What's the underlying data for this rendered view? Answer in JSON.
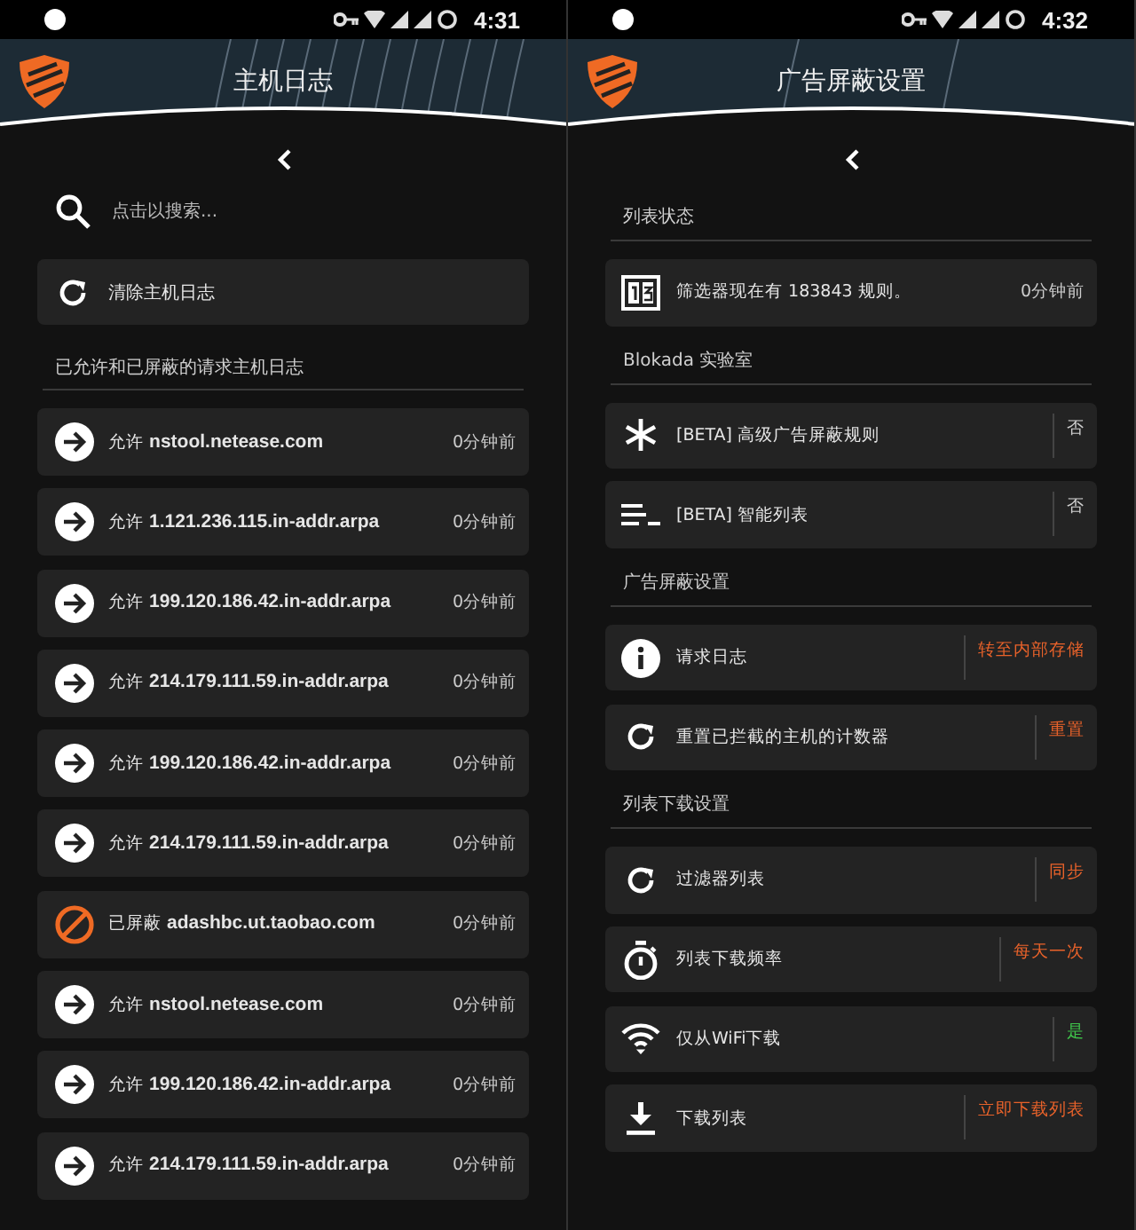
{
  "screens": [
    {
      "status_bar": {
        "time": "4:31"
      },
      "title": "主机日志",
      "search": {
        "placeholder": "点击以搜索..."
      },
      "clear_button": "清除主机日志",
      "section": "已允许和已屏蔽的请求主机日志",
      "log": [
        {
          "kind": "allowed",
          "text": "允许 **nstool.netease.com**",
          "time": "0分钟前"
        },
        {
          "kind": "allowed",
          "text": "允许 **1.121.236.115.in-addr.arpa**",
          "time": "0分钟前"
        },
        {
          "kind": "allowed",
          "text": "允许 **199.120.186.42.in-addr.arpa**",
          "time": "0分钟前"
        },
        {
          "kind": "allowed",
          "text": "允许 **214.179.111.59.in-addr.arpa**",
          "time": "0分钟前"
        },
        {
          "kind": "allowed",
          "text": "允许 **199.120.186.42.in-addr.arpa**",
          "time": "0分钟前"
        },
        {
          "kind": "allowed",
          "text": "允许 **214.179.111.59.in-addr.arpa**",
          "time": "0分钟前"
        },
        {
          "kind": "blocked",
          "text": "已屏蔽 **adashbc.ut.taobao.com**",
          "time": "0分钟前"
        },
        {
          "kind": "allowed",
          "text": "允许 **nstool.netease.com**",
          "time": "0分钟前"
        },
        {
          "kind": "allowed",
          "text": "允许 **199.120.186.42.in-addr.arpa**",
          "time": "0分钟前"
        },
        {
          "kind": "allowed",
          "text": "允许 **214.179.111.59.in-addr.arpa**",
          "time": "0分钟前"
        }
      ]
    },
    {
      "status_bar": {
        "time": "4:32"
      },
      "title": "广告屏蔽设置",
      "sections": [
        {
          "title": "列表状态",
          "items": [
            {
              "kind": "counter",
              "label": "筛选器现在有 183843 规则。",
              "time": "0分钟前"
            }
          ]
        },
        {
          "title": "Blokada 实验室",
          "items": [
            {
              "kind": "asterisk",
              "label": "[BETA] 高级广告屏蔽规则",
              "value": "否",
              "color": "#cfcfcf"
            },
            {
              "kind": "lines",
              "label": "[BETA] 智能列表",
              "value": "否",
              "color": "#cfcfcf"
            }
          ]
        },
        {
          "title": "广告屏蔽设置",
          "items": [
            {
              "kind": "info",
              "label": "请求日志",
              "value": "转至内部存储",
              "color": "#e8622a"
            },
            {
              "kind": "reset",
              "label": "重置已拦截的主机的计数器",
              "value": "重置",
              "color": "#e8622a"
            }
          ]
        },
        {
          "title": "列表下载设置",
          "items": [
            {
              "kind": "refresh",
              "label": "过滤器列表",
              "value": "同步",
              "color": "#e8622a"
            },
            {
              "kind": "stopwatch",
              "label": "列表下载频率",
              "value": "每天一次",
              "color": "#e8622a"
            },
            {
              "kind": "wifi",
              "label": "仅从WiFi下载",
              "value": "是",
              "color": "#3fc24a"
            },
            {
              "kind": "download",
              "label": "下载列表",
              "value": "立即下载列表",
              "color": "#e8622a"
            }
          ]
        }
      ]
    }
  ]
}
